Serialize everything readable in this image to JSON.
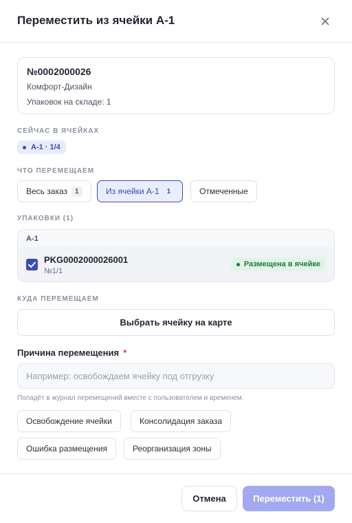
{
  "dialog": {
    "title": "Переместить из ячейки А-1"
  },
  "order": {
    "number": "№0002000026",
    "client": "Комфорт-Дизайн",
    "packs_on_stock": "Упаковок на складе: 1"
  },
  "current_cells": {
    "label": "СЕЙЧАС В ЯЧЕЙКАХ",
    "chip": "А-1 · 1/4"
  },
  "what_to_move": {
    "label": "ЧТО ПЕРЕМЕЩАЕМ",
    "options": [
      {
        "label": "Весь заказ",
        "count": "1"
      },
      {
        "label": "Из ячейки А-1",
        "count": "1"
      },
      {
        "label": "Отмеченные"
      }
    ],
    "selected": "Из ячейки А-1"
  },
  "packages": {
    "label": "УПАКОВКИ (1)",
    "group": "А-1",
    "items": [
      {
        "id": "PKG0002000026001",
        "sub": "№1/1",
        "status": "Размещена в ячейке",
        "checked": true
      }
    ]
  },
  "destination": {
    "label": "КУДА ПЕРЕМЕЩАЕМ",
    "map_button": "Выбрать ячейку на карте"
  },
  "reason": {
    "label": "Причина перемещения",
    "required_mark": "*",
    "placeholder": "Например: освобождаем ячейку под отгрузку",
    "value": "",
    "hint": "Попадёт в журнал перемещений вместе с пользователем и временем.",
    "presets": [
      "Освобождение ячейки",
      "Консолидация заказа",
      "Ошибка размещения",
      "Реорганизация зоны"
    ]
  },
  "footer": {
    "cancel": "Отмена",
    "submit": "Переместить (1)"
  },
  "colors": {
    "accent": "#3b4bb8",
    "accent_light": "#eaedfc",
    "success": "#1e7a3c",
    "submit_disabled": "#a3a9f0",
    "required": "#d93a3a"
  },
  "icons": {
    "close": "close-icon",
    "check": "check-icon"
  }
}
